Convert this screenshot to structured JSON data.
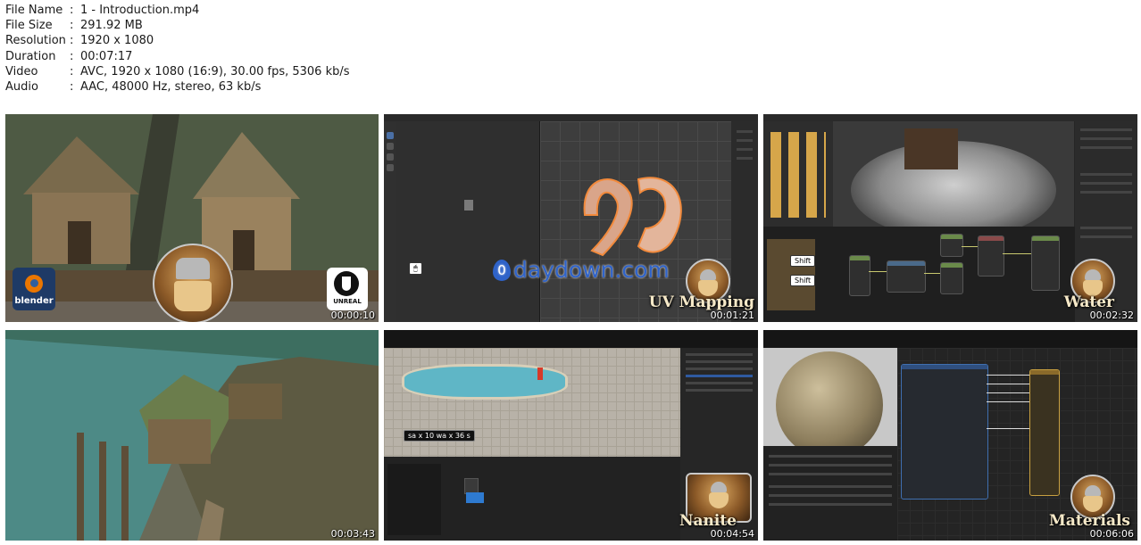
{
  "file_info": [
    {
      "key": "File Name",
      "value": "1 - Introduction.mp4"
    },
    {
      "key": "File Size",
      "value": "291.92 MB"
    },
    {
      "key": "Resolution",
      "value": "1920 x 1080"
    },
    {
      "key": "Duration",
      "value": "00:07:17"
    },
    {
      "key": "Video",
      "value": "AVC, 1920 x 1080 (16:9), 30.00 fps, 5306 kb/s"
    },
    {
      "key": "Audio",
      "value": "AAC, 48000 Hz, stereo, 63 kb/s"
    }
  ],
  "separator": ":",
  "thumbnails": [
    {
      "timestamp": "00:00:10",
      "caption": "",
      "logos": {
        "left": "blender",
        "right": "UNREAL"
      }
    },
    {
      "timestamp": "00:01:21",
      "caption": "UV Mapping"
    },
    {
      "timestamp": "00:02:32",
      "caption": "Water"
    },
    {
      "timestamp": "00:03:43",
      "caption": ""
    },
    {
      "timestamp": "00:04:54",
      "caption": "Nanite"
    },
    {
      "timestamp": "00:06:06",
      "caption": "Materials"
    }
  ],
  "watermark": {
    "text": "daydown.com",
    "glyph": "0"
  },
  "overlays": {
    "keycap_shift_1": "Shift",
    "keycap_shift_2": "Shift",
    "nanite_stats": "sa x 10 wa x 36 s"
  },
  "colors": {
    "caption": "#f6e9c8",
    "watermark": "#2f63c9",
    "node_wire": "#c8c86e"
  }
}
